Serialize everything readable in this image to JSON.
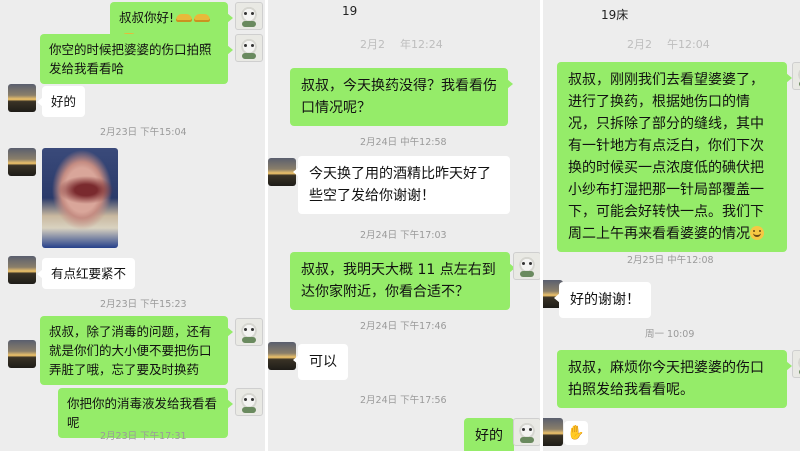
{
  "panel1": {
    "messages": [
      {
        "id": "p1m1",
        "text": "叔叔你好!"
      },
      {
        "id": "p1m2",
        "text": "你空的时候把婆婆的伤口拍照发给我看看哈"
      },
      {
        "id": "p1m3",
        "text": "好的"
      },
      {
        "id": "p1m4",
        "text": "有点红要紧不"
      },
      {
        "id": "p1m5",
        "text": "叔叔，除了消毒的问题，还有就是你们的大小便不要把伤口弄脏了哦，忘了要及时换药"
      },
      {
        "id": "p1m6",
        "text": "你把你的消毒液发给我看看呢"
      }
    ],
    "timestamps": [
      "2月23日 下午15:04",
      "2月23日 下午15:23",
      "2月23日 下午17:31"
    ]
  },
  "panel2": {
    "status_top": "19",
    "watermark_1": "2月2",
    "watermark_2": "年12:24",
    "messages": [
      {
        "id": "p2m1",
        "text": "叔叔，今天换药没得？我看看伤口情况呢？"
      },
      {
        "id": "p2m2",
        "text": "今天换了用的酒精比昨天好了些空了发给你谢谢！"
      },
      {
        "id": "p2m3",
        "text": "叔叔，我明天大概 11 点左右到达你家附近，你看合适不？"
      },
      {
        "id": "p2m4",
        "text": "可以"
      },
      {
        "id": "p2m5",
        "text": "好的"
      }
    ],
    "timestamps": [
      "2月24日 中午12:58",
      "2月24日 下午17:03",
      "2月24日 下午17:46",
      "2月24日 下午17:56"
    ]
  },
  "panel3": {
    "status_top": "19床",
    "watermark_1": "2月2",
    "watermark_2": "午12:04",
    "messages": [
      {
        "id": "p3m1",
        "text": "叔叔，刚刚我们去看望婆婆了，进行了换药，根据她伤口的情况，只拆除了部分的缝线，其中有一针地方有点泛白，你们下次换的时候买一点浓度低的碘伏把小纱布打湿把那一针局部覆盖一下，可能会好转快一点。我们下周二上午再来看看婆婆的情况"
      },
      {
        "id": "p3m2",
        "text": "好的谢谢！"
      },
      {
        "id": "p3m3",
        "text": "叔叔，麻烦你今天把婆婆的伤口拍照发给我看看呢。"
      }
    ],
    "timestamps": [
      "2月25日 中午12:08",
      "周一 10:09"
    ]
  },
  "icons": {
    "gold_ingots": "gold-ingot-icon",
    "smile": "smile-emoji-icon",
    "wave": "waving-hand-emoji-icon"
  },
  "colors": {
    "chat_background": "#ededed",
    "sent_bubble": "#95ec69",
    "received_bubble": "#ffffff",
    "timestamp_text": "#9a9a9a"
  }
}
